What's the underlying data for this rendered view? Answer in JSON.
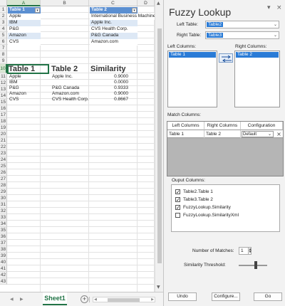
{
  "sheet": {
    "columns": [
      "A",
      "B",
      "C",
      "D"
    ],
    "rows": [
      "1",
      "2",
      "3",
      "4",
      "5",
      "6",
      "7",
      "8",
      "9",
      "10",
      "11",
      "12",
      "13",
      "14",
      "15",
      "16",
      "17",
      "18",
      "19",
      "20",
      "21",
      "22",
      "23",
      "24",
      "25",
      "26",
      "27",
      "28",
      "29",
      "30",
      "31",
      "32",
      "33",
      "34",
      "35",
      "36",
      "37",
      "38",
      "39",
      "40",
      "41",
      "42",
      "43"
    ],
    "table1": {
      "header": "Table 1",
      "values": [
        "Apple",
        "IBM",
        "P&G",
        "Amazon",
        "CVS"
      ]
    },
    "table2": {
      "header": "Table 2",
      "values": [
        "International Business Machines",
        "Apple Inc.",
        "CVS Health Corp.",
        "P&G Canada",
        "Amazon.com"
      ]
    },
    "results": {
      "headers": [
        "Table 1",
        "Table 2",
        "Similarity"
      ],
      "rows": [
        {
          "t1": "Apple",
          "t2": "Apple Inc.",
          "sim": "0.9000"
        },
        {
          "t1": "IBM",
          "t2": "",
          "sim": "0.0000"
        },
        {
          "t1": "P&G",
          "t2": "P&G Canada",
          "sim": "0.9333"
        },
        {
          "t1": "Amazon",
          "t2": "Amazon.com",
          "sim": "0.9000"
        },
        {
          "t1": "CVS",
          "t2": "CVS Health Corp.",
          "sim": "0.8667"
        }
      ]
    },
    "tab_name": "Sheet1",
    "add_sheet": "+"
  },
  "pane": {
    "title": "Fuzzy Lookup",
    "controls": {
      "options": "▾",
      "close": "×"
    },
    "left_table_label": "Left Table:",
    "left_table_value": "Table2",
    "right_table_label": "Right Table:",
    "right_table_value": "Table3",
    "left_columns_label": "Left Columns:",
    "left_columns": [
      "Table 1"
    ],
    "right_columns_label": "Right Columns:",
    "right_columns": [
      "Table 2"
    ],
    "match_columns_label": "Match Columns:",
    "match_headers": [
      "Left Columns",
      "Right Columns",
      "Configuration"
    ],
    "match_row": {
      "left": "Table 1",
      "right": "Table 2",
      "config": "Default",
      "remove": "×"
    },
    "output_columns_label": "Ouput Columns:",
    "output_columns": [
      {
        "label": "Table2.Table 1",
        "checked": true
      },
      {
        "label": "Table3.Table 2",
        "checked": true
      },
      {
        "label": "FuzzyLookup.Similarity",
        "checked": true
      },
      {
        "label": "FuzzyLookup.SimilarityXml",
        "checked": false
      }
    ],
    "number_of_matches_label": "Number of Matches:",
    "number_of_matches": "1",
    "similarity_threshold_label": "Similarity Threshold:",
    "similarity_threshold": 0.6,
    "buttons": {
      "undo": "Undo",
      "configure": "Configure...",
      "go": "Go"
    }
  }
}
